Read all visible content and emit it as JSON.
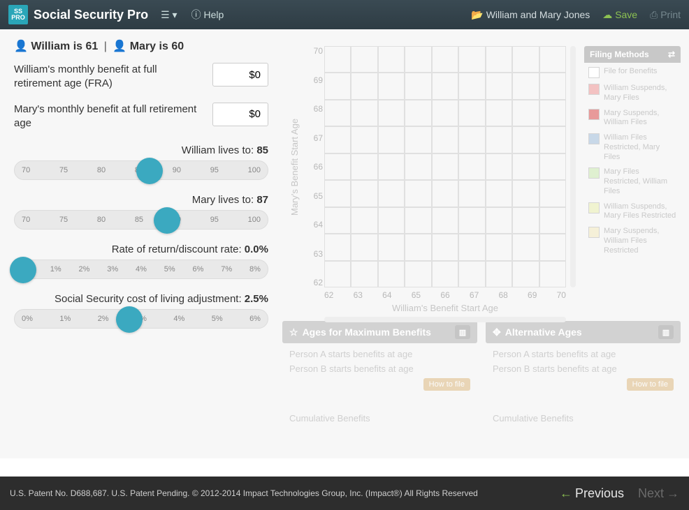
{
  "brand": {
    "logo_top": "SS",
    "logo_bottom": "PRO",
    "title": "Social Security Pro"
  },
  "topbar": {
    "help_label": "Help",
    "client_name": "William and Mary Jones",
    "save_label": "Save",
    "print_label": "Print"
  },
  "persons": {
    "a_name": "William",
    "a_age": "61",
    "b_name": "Mary",
    "b_age": "60"
  },
  "fields": {
    "a_fra_label": "William's monthly benefit at full retirement age (FRA)",
    "a_fra_value": "$0",
    "b_fra_label": "Mary's monthly benefit at full retirement age",
    "b_fra_value": "$0"
  },
  "sliders": {
    "life_a": {
      "label": "William lives to:",
      "value": "85",
      "ticks": [
        "70",
        "75",
        "80",
        "85",
        "90",
        "95",
        "100"
      ],
      "thumb_pct": 48
    },
    "life_b": {
      "label": "Mary lives to:",
      "value": "87",
      "ticks": [
        "70",
        "75",
        "80",
        "85",
        "90",
        "95",
        "100"
      ],
      "thumb_pct": 55
    },
    "rate": {
      "label": "Rate of return/discount rate:",
      "value": "0.0%",
      "ticks": [
        "0%",
        "1%",
        "2%",
        "3%",
        "4%",
        "5%",
        "6%",
        "7%",
        "8%"
      ],
      "thumb_pct": -2
    },
    "cola": {
      "label": "Social Security cost of living adjustment:",
      "value": "2.5%",
      "ticks": [
        "0%",
        "1%",
        "2%",
        "3%",
        "4%",
        "5%",
        "6%"
      ],
      "thumb_pct": 40
    }
  },
  "chart_data": {
    "type": "heatmap",
    "title": "Filing Methods",
    "xlabel": "William's Benefit Start Age",
    "ylabel": "Mary's Benefit Start Age",
    "x_ticks": [
      "62",
      "63",
      "64",
      "65",
      "66",
      "67",
      "68",
      "69",
      "70"
    ],
    "y_ticks": [
      "70",
      "69",
      "68",
      "67",
      "66",
      "65",
      "64",
      "63",
      "62"
    ],
    "xlim": [
      62,
      70
    ],
    "ylim": [
      62,
      70
    ],
    "series": [],
    "legend_entries": [
      "File for Benefits",
      "William Suspends, Mary Files",
      "Mary Suspends, William Files",
      "William Files Restricted, Mary Files",
      "Mary Files Restricted, William Files",
      "William Suspends, Mary Files Restricted",
      "Mary Suspends, William Files Restricted"
    ],
    "legend_colors": [
      "#ffffff",
      "#f3c2c2",
      "#e89a9a",
      "#c8d8e8",
      "#dff0d0",
      "#f0f3d0",
      "#f5f0d8"
    ]
  },
  "cards": {
    "max": {
      "title": "Ages for Maximum Benefits",
      "line1": "Person A starts benefits at age",
      "line2": "Person B starts benefits at age",
      "how_label": "How to file",
      "cumulative_label": "Cumulative Benefits"
    },
    "alt": {
      "title": "Alternative Ages",
      "line1": "Person A starts benefits at age",
      "line2": "Person B starts benefits at age",
      "how_label": "How to file",
      "cumulative_label": "Cumulative Benefits"
    }
  },
  "footer": {
    "patent": "U.S. Patent No. D688,687. U.S. Patent Pending. © 2012-2014 Impact Technologies Group, Inc. (Impact®) All Rights Reserved",
    "prev_label": "Previous",
    "next_label": "Next"
  }
}
